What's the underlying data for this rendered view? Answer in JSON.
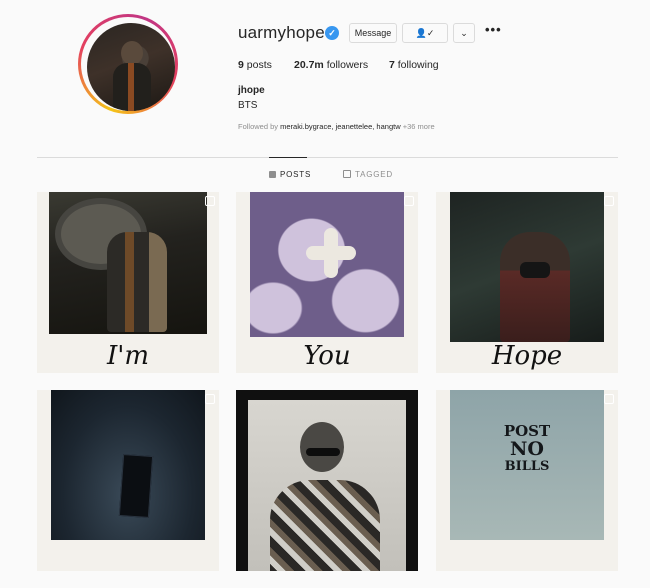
{
  "profile": {
    "username": "uarmyhope",
    "verified_icon": "verified-badge-icon",
    "buttons": {
      "message": "Message",
      "follow_icon": "following-check-icon",
      "dropdown_icon": "chevron-down-icon"
    },
    "more_icon": "more-options-icon",
    "stats": {
      "posts_count": "9",
      "posts_label": "posts",
      "followers_count": "20.7m",
      "followers_label": "followers",
      "following_count": "7",
      "following_label": "following"
    },
    "full_name": "jhope",
    "bio": "BTS",
    "followed_by_prefix": "Followed by",
    "followed_by_users": "meraki.bygrace, jeanettelee, hangtw",
    "followed_by_more": "+36 more"
  },
  "tabs": [
    {
      "label": "POSTS",
      "icon": "grid-icon",
      "active": true
    },
    {
      "label": "TAGGED",
      "icon": "tag-icon",
      "active": false
    }
  ],
  "posts": [
    {
      "caption": "I'm"
    },
    {
      "caption": "You"
    },
    {
      "caption": "Hope"
    },
    {
      "caption": ""
    },
    {
      "caption": ""
    },
    {
      "caption": "",
      "sign_lines": [
        "POST",
        "NO",
        "BILLS"
      ]
    }
  ],
  "colors": {
    "accent": "#3897f0",
    "text": "#262626",
    "muted": "#8e8e8e",
    "border": "#dbdbdb"
  }
}
